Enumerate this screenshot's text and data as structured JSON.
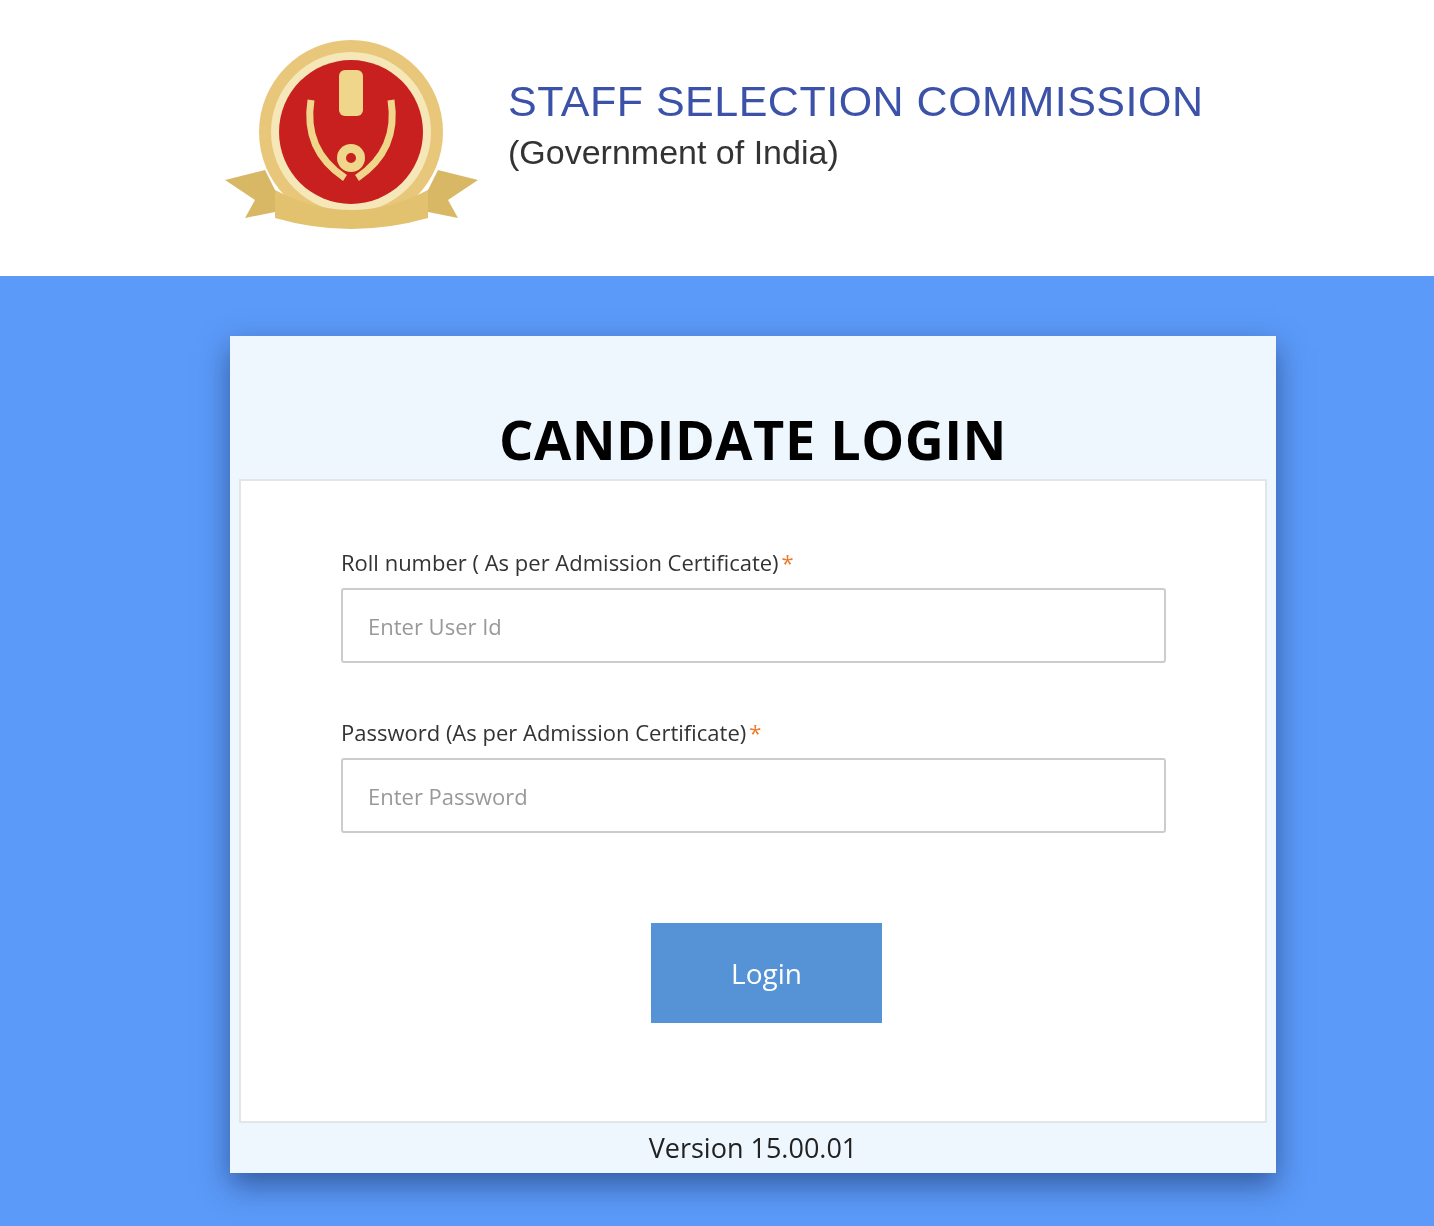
{
  "header": {
    "title": "STAFF SELECTION COMMISSION",
    "subtitle": "(Government of India)"
  },
  "login": {
    "title": "CANDIDATE LOGIN",
    "fields": [
      {
        "label": "Roll number ( As per Admission Certificate)",
        "required_mark": "*",
        "placeholder": "Enter User Id"
      },
      {
        "label": "Password (As per Admission Certificate)",
        "required_mark": "*",
        "placeholder": "Enter Password"
      }
    ],
    "button": "Login",
    "version": "Version 15.00.01"
  }
}
